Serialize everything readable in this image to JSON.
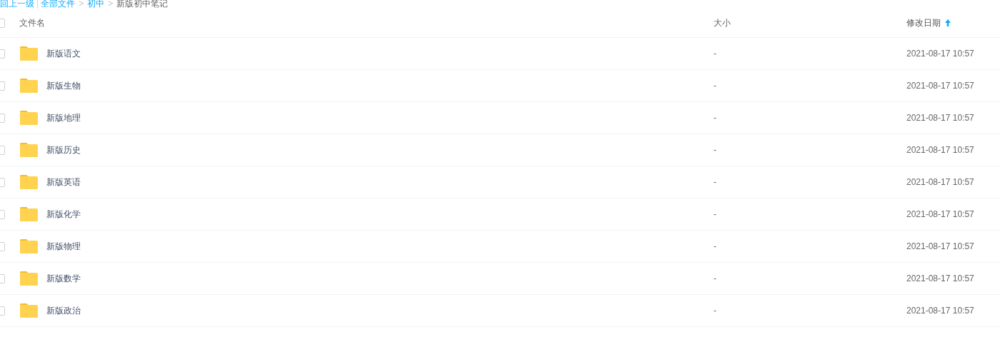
{
  "breadcrumb": [
    {
      "label": "回上一级",
      "kind": "link"
    },
    {
      "separator": "|",
      "label": "全部文件",
      "kind": "link"
    },
    {
      "separator": ">",
      "label": "初中",
      "kind": "link"
    },
    {
      "separator": ">",
      "label": "新版初中笔记",
      "kind": "current"
    }
  ],
  "table": {
    "select_all": {
      "checked": false
    },
    "columns": [
      {
        "label": "文件名",
        "sorted": false
      },
      {
        "label": "大小",
        "sorted": false
      },
      {
        "label": "修改日期",
        "sorted": true
      }
    ],
    "rows": [
      {
        "name": "新版语文",
        "size": "-",
        "modified": "2021-08-17 10:57",
        "checked": false
      },
      {
        "name": "新版生物",
        "size": "-",
        "modified": "2021-08-17 10:57",
        "checked": false
      },
      {
        "name": "新版地理",
        "size": "-",
        "modified": "2021-08-17 10:57",
        "checked": false
      },
      {
        "name": "新版历史",
        "size": "-",
        "modified": "2021-08-17 10:57",
        "checked": false
      },
      {
        "name": "新版英语",
        "size": "-",
        "modified": "2021-08-17 10:57",
        "checked": false
      },
      {
        "name": "新版化学",
        "size": "-",
        "modified": "2021-08-17 10:57",
        "checked": false
      },
      {
        "name": "新版物理",
        "size": "-",
        "modified": "2021-08-17 10:57",
        "checked": false
      },
      {
        "name": "新版数学",
        "size": "-",
        "modified": "2021-08-17 10:57",
        "checked": false
      },
      {
        "name": "新版政治",
        "size": "-",
        "modified": "2021-08-17 10:57",
        "checked": false
      }
    ]
  }
}
